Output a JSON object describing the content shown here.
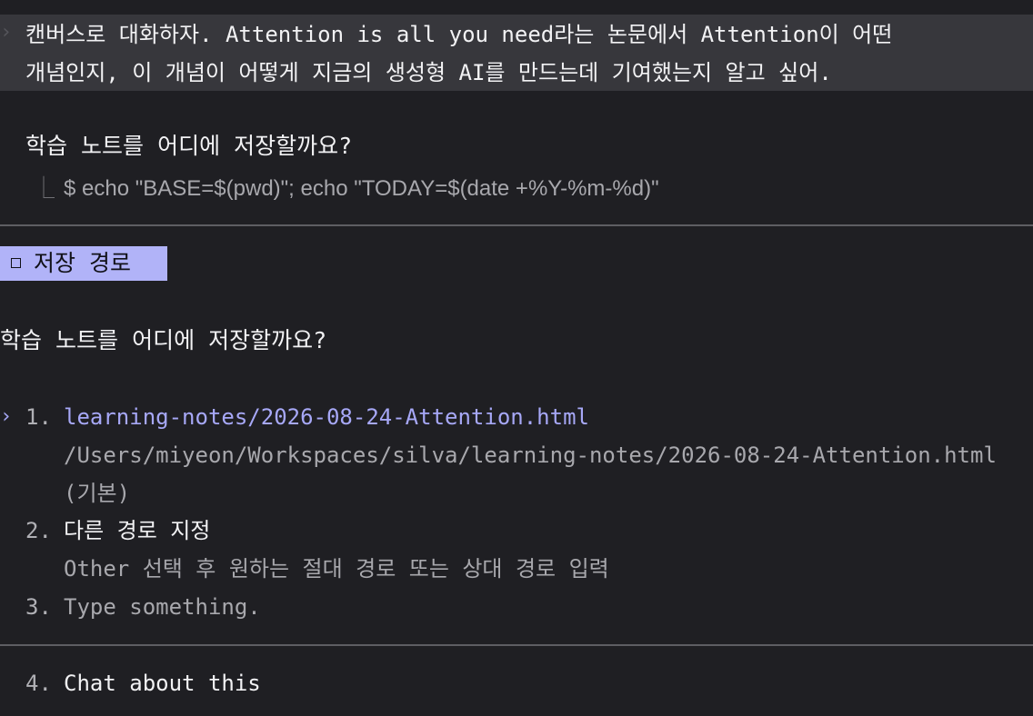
{
  "conversation": {
    "user_caret": "›",
    "user_message_lines": [
      "캔버스로 대화하자. Attention is all you need라는 논문에서 Attention이 어떤",
      "개념인지, 이 개념이 어떻게 지금의 생성형 AI를 만드는데 기여했는지 알고 싶어."
    ],
    "assistant_question": "학습 노트를 어디에 저장할까요?",
    "tool_corner": "⎿",
    "tool_command": "$ echo \"BASE=$(pwd)\"; echo \"TODAY=$(date +%Y-%m-%d)\""
  },
  "prompt": {
    "section_label": "저장 경로",
    "question": "학습 노트를 어디에 저장할까요?",
    "pointer": "›",
    "options": [
      {
        "number": "1.",
        "label": "learning-notes/2026-08-24-Attention.html",
        "description_lines": [
          "/Users/miyeon/Workspaces/silva/learning-notes/2026-08-24-Attention.html",
          "(기본)"
        ]
      },
      {
        "number": "2.",
        "label": "다른 경로 지정",
        "description_lines": [
          "Other 선택 후 원하는 절대 경로 또는 상대 경로 입력"
        ]
      },
      {
        "number": "3.",
        "label": "Type something."
      },
      {
        "number": "4.",
        "label": "Chat about this"
      }
    ]
  },
  "colors": {
    "background": "#1f1f23",
    "user_message_bg": "#37373c",
    "accent": "#a7a8f7",
    "section_tag_bg": "#b1b3f8",
    "divider": "#5e5e63"
  }
}
